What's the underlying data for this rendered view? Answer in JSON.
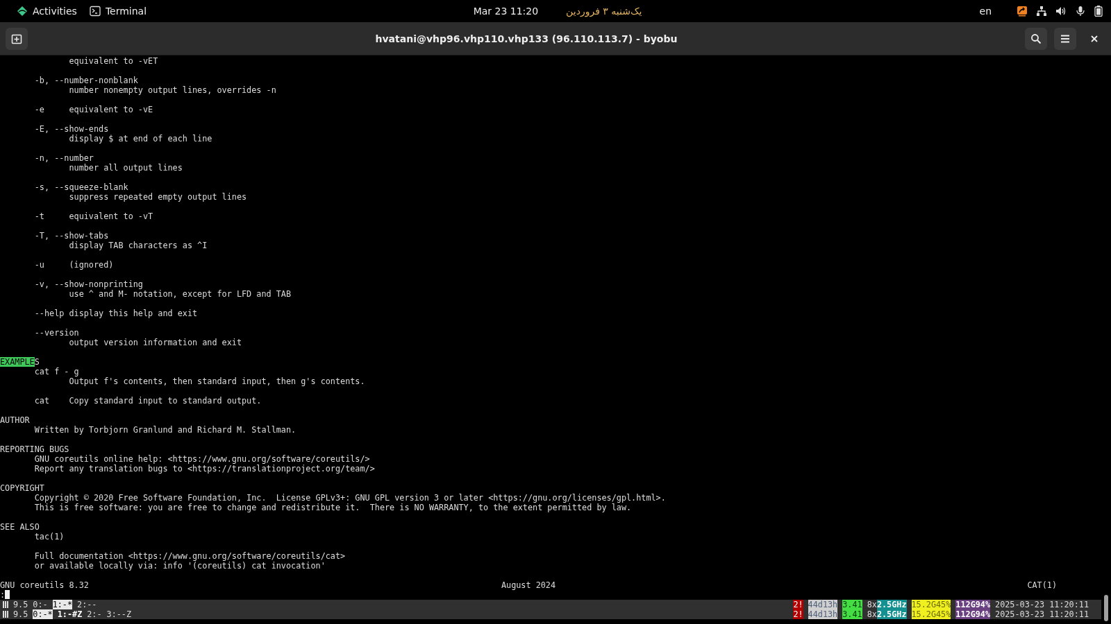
{
  "top_bar": {
    "activities": "Activities",
    "app": "Terminal",
    "date": "Mar 23  11:20",
    "local_date": "یک‌شنبه ۳ فروردین",
    "input_language": "en"
  },
  "window": {
    "title": "hvatani@vhp96.vhp110.vhp133 (96.110.113.7) - byobu"
  },
  "man_page": {
    "blocks": [
      {
        "lines": [
          "              equivalent to -vET"
        ]
      },
      {
        "lines": [
          "       -b, --number-nonblank",
          "              number nonempty output lines, overrides -n"
        ]
      },
      {
        "lines": [
          "       -e     equivalent to -vE"
        ]
      },
      {
        "lines": [
          "       -E, --show-ends",
          "              display $ at end of each line"
        ]
      },
      {
        "lines": [
          "       -n, --number",
          "              number all output lines"
        ]
      },
      {
        "lines": [
          "       -s, --squeeze-blank",
          "              suppress repeated empty output lines"
        ]
      },
      {
        "lines": [
          "       -t     equivalent to -vT"
        ]
      },
      {
        "lines": [
          "       -T, --show-tabs",
          "              display TAB characters as ^I"
        ]
      },
      {
        "lines": [
          "       -u     (ignored)"
        ]
      },
      {
        "lines": [
          "       -v, --show-nonprinting",
          "              use ^ and M- notation, except for LFD and TAB"
        ]
      },
      {
        "lines": [
          "       --help display this help and exit"
        ]
      },
      {
        "lines": [
          "       --version",
          "              output version information and exit"
        ]
      },
      {
        "heading": [
          {
            "text": "EXAMPLE",
            "highlighted": true
          },
          {
            "text": "S",
            "highlighted": false
          }
        ],
        "lines": [
          "       cat f - g",
          "              Output f's contents, then standard input, then g's contents."
        ]
      },
      {
        "lines": [
          "       cat    Copy standard input to standard output."
        ]
      },
      {
        "lines": [
          "AUTHOR",
          "       Written by Torbjorn Granlund and Richard M. Stallman."
        ]
      },
      {
        "lines": [
          "REPORTING BUGS",
          "       GNU coreutils online help: <https://www.gnu.org/software/coreutils/>",
          "       Report any translation bugs to <https://translationproject.org/team/>"
        ]
      },
      {
        "lines": [
          "COPYRIGHT",
          "       Copyright © 2020 Free Software Foundation, Inc.  License GPLv3+: GNU GPL version 3 or later <https://gnu.org/licenses/gpl.html>.",
          "       This is free software: you are free to change and redistribute it.  There is NO WARRANTY, to the extent permitted by law."
        ]
      },
      {
        "lines": [
          "SEE ALSO",
          "       tac(1)"
        ]
      },
      {
        "lines": [
          "       Full documentation <https://www.gnu.org/software/coreutils/cat>",
          "       or available locally via: info '(coreutils) cat invocation'"
        ]
      }
    ],
    "footer": {
      "left": "GNU coreutils 8.32",
      "center": "August 2024",
      "right": "CAT(1)"
    },
    "prompt": ":"
  },
  "status_lines": [
    {
      "version": "9.5",
      "windows": [
        {
          "label": "0:-",
          "selected": false,
          "bold": false
        },
        {
          "label": "1:-*",
          "selected": true,
          "bold": false
        },
        {
          "label": "2:--",
          "selected": false,
          "bold": false
        }
      ],
      "widgets": [
        {
          "kind": "alert",
          "text": "2!"
        },
        {
          "kind": "uptime",
          "text": "44d13h"
        },
        {
          "kind": "load",
          "text": "3.41"
        },
        {
          "kind": "cpu_count",
          "text": "8x"
        },
        {
          "kind": "cpu_freq",
          "text": "2.5GHz"
        },
        {
          "kind": "memory",
          "text": "15.2G45%"
        },
        {
          "kind": "disk",
          "text": "112G94%"
        },
        {
          "kind": "clock",
          "text": "2025-03-23 11:20:11"
        }
      ]
    },
    {
      "version": "9.5",
      "windows": [
        {
          "label": "0:-*",
          "selected": true,
          "bold": false
        },
        {
          "label": "1:-#Z",
          "selected": false,
          "bold": true
        },
        {
          "label": "2:-",
          "selected": false,
          "bold": false
        },
        {
          "label": "3:--Z",
          "selected": false,
          "bold": false
        }
      ],
      "widgets": [
        {
          "kind": "alert",
          "text": "2!"
        },
        {
          "kind": "uptime",
          "text": "44d13h"
        },
        {
          "kind": "load",
          "text": "3.41"
        },
        {
          "kind": "cpu_count",
          "text": "8x"
        },
        {
          "kind": "cpu_freq",
          "text": "2.5GHz"
        },
        {
          "kind": "memory",
          "text": "15.2G45%"
        },
        {
          "kind": "disk",
          "text": "112G94%"
        },
        {
          "kind": "clock",
          "text": "2025-03-23 11:20:11"
        }
      ]
    }
  ]
}
